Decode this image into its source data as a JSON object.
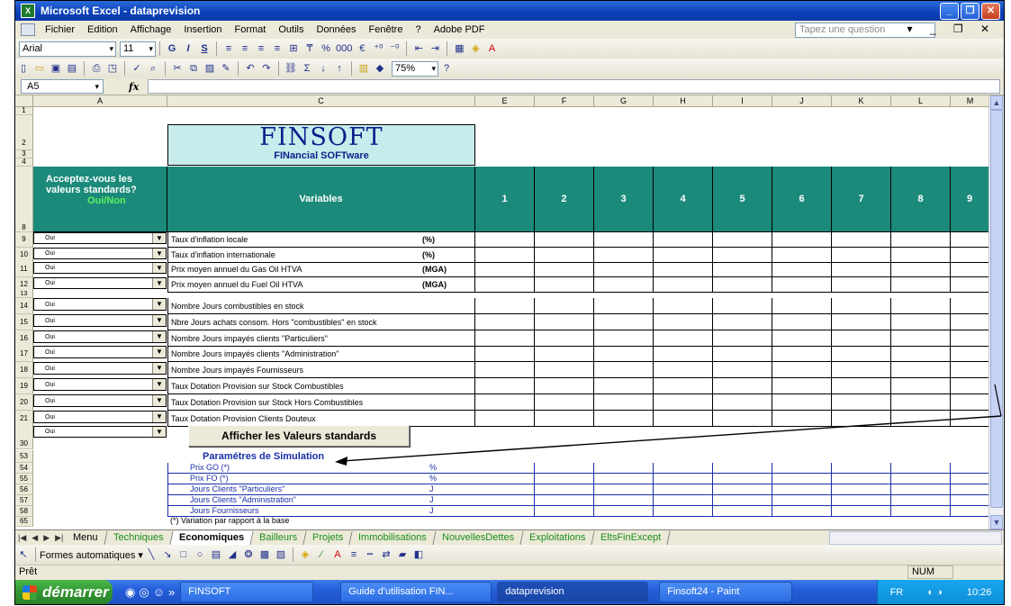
{
  "window": {
    "title": "Microsoft Excel - dataprevision",
    "minimize": "_",
    "restore": "❐",
    "close": "✕"
  },
  "menu": {
    "items": [
      "Fichier",
      "Edition",
      "Affichage",
      "Insertion",
      "Format",
      "Outils",
      "Données",
      "Fenêtre",
      "?",
      "Adobe PDF"
    ],
    "ask_placeholder": "Tapez une question",
    "right_controls": "▾ _ ❐ ✕"
  },
  "format_toolbar": {
    "font": "Arial",
    "size": "11",
    "bold": "G",
    "italic": "I",
    "underline": "S",
    "percent": "%",
    "thousands": "000",
    "euro": "€"
  },
  "standard_toolbar": {
    "zoom": "75%"
  },
  "formula_bar": {
    "name_box": "A5",
    "fx": "fx"
  },
  "columns": [
    "A",
    "C",
    "E",
    "F",
    "G",
    "H",
    "I",
    "J",
    "K",
    "L",
    "M"
  ],
  "header_block": {
    "logo_title": "FINSOFT",
    "logo_subtitle": "FINancial SOFTware",
    "accept_question": "Acceptez-vous les valeurs standards?",
    "accept_options": "Oui/Non",
    "variables_header": "Variables",
    "period_headers": [
      "1",
      "2",
      "3",
      "4",
      "5",
      "6",
      "7",
      "8",
      "9"
    ]
  },
  "rows_group1": [
    {
      "row": "9",
      "choice": "Oui",
      "label": "Taux d'inflation locale",
      "unit": "(%)"
    },
    {
      "row": "10",
      "choice": "Oui",
      "label": "Taux d'inflation internationale",
      "unit": "(%)"
    },
    {
      "row": "11",
      "choice": "Oui",
      "label": "Prix moyen annuel du Gas Oil HTVA",
      "unit": "(MGA)"
    },
    {
      "row": "12",
      "choice": "Oui",
      "label": "Prix moyen annuel du Fuel Oil HTVA",
      "unit": "(MGA)"
    }
  ],
  "rows_group2": [
    {
      "row": "14",
      "choice": "Oui",
      "label": "Nombre Jours combustibles en stock"
    },
    {
      "row": "15",
      "choice": "Oui",
      "label": "Nbre Jours achats consom. Hors \"combustibles\"  en stock"
    },
    {
      "row": "16",
      "choice": "Oui",
      "label": "Nombre Jours impayés clients \"Particuliers\""
    },
    {
      "row": "17",
      "choice": "Oui",
      "label": "Nombre Jours impayés clients \"Administration\""
    },
    {
      "row": "18",
      "choice": "Oui",
      "label": "Nombre Jours impayés Fournisseurs"
    },
    {
      "row": "19",
      "choice": "Oui",
      "label": "Taux Dotation Provision sur Stock Combustibles"
    },
    {
      "row": "20",
      "choice": "Oui",
      "label": "Taux Dotation Provision sur Stock Hors Combustibles"
    },
    {
      "row": "21",
      "choice": "Oui",
      "label": "Taux Dotation Provision Clients Douteux"
    }
  ],
  "extra_choice": "Oui",
  "show_defaults_button": "Afficher les Valeurs standards",
  "simulation": {
    "title": "Paramétres de Simulation",
    "rows": [
      {
        "row": "54",
        "label": "Prix GO   (*)",
        "unit": "%"
      },
      {
        "row": "55",
        "label": "Prix FO   (*)",
        "unit": "%"
      },
      {
        "row": "56",
        "label": "Jours Clients \"Particuliers\"",
        "unit": "J"
      },
      {
        "row": "57",
        "label": "Jours Clients \"Administration\"",
        "unit": "J"
      },
      {
        "row": "58",
        "label": "Jours Fournisseurs",
        "unit": "J"
      }
    ],
    "footnote": "(*) Variation par rapport à la base"
  },
  "row_numbers_misc": {
    "r1": "1",
    "r2": "2",
    "r3": "3",
    "r4": "4",
    "r8": "8",
    "r13": "13",
    "r30": "30",
    "r53": "53",
    "r65": "65"
  },
  "sheet_tabs": [
    "Menu",
    "Techniques",
    "Economiques",
    "Bailleurs",
    "Projets",
    "Immobilisations",
    "NouvellesDettes",
    "Exploitations",
    "EltsFinExcept"
  ],
  "active_tab": "Economiques",
  "draw_toolbar": {
    "autoshapes": "Formes automatiques ▾"
  },
  "status": {
    "ready": "Prêt",
    "num": "NUM"
  },
  "taskbar": {
    "start": "démarrer",
    "tasks": [
      "FINSOFT",
      "Guide d'utilisation FIN...",
      "dataprevision",
      "Finsoft24 - Paint"
    ],
    "lang": "FR",
    "clock": "10:26"
  }
}
